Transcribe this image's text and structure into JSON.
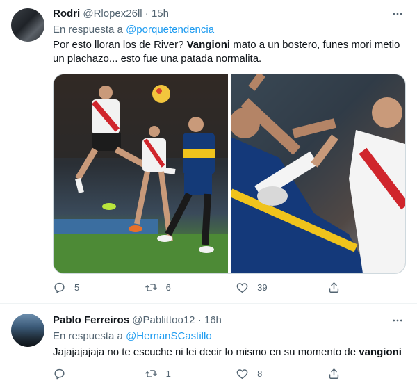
{
  "tweets": [
    {
      "name": "Rodri",
      "handle": "@Rlopex26ll",
      "dot": "·",
      "time": "15h",
      "reply_prefix": "En respuesta a",
      "reply_to": "@porquetendencia",
      "text_before": "Por esto lloran los de River? ",
      "text_bold": "Vangioni",
      "text_after": " mato a un bostero, funes mori metio un plachazo... esto fue una patada normalita.",
      "stats": {
        "replies": "5",
        "retweets": "6",
        "likes": "39"
      },
      "photos": [
        "soccer-photo-1",
        "soccer-photo-2"
      ]
    },
    {
      "name": "Pablo Ferreiros",
      "handle": "@Pablittoo12",
      "dot": "·",
      "time": "16h",
      "reply_prefix": "En respuesta a",
      "reply_to": "@HernanSCastillo",
      "text_before": "Jajajajajaja no te escuche ni lei decir lo mismo en su momento de ",
      "text_bold": "vangioni",
      "text_after": "",
      "stats": {
        "replies": "",
        "retweets": "1",
        "likes": "8"
      }
    }
  ],
  "icons": {
    "reply": "reply-icon",
    "retweet": "retweet-icon",
    "like": "heart-icon",
    "share": "share-icon",
    "more": "more-icon"
  },
  "colors": {
    "link": "#1d9bf0",
    "muted": "#536471",
    "text": "#0f1419"
  }
}
